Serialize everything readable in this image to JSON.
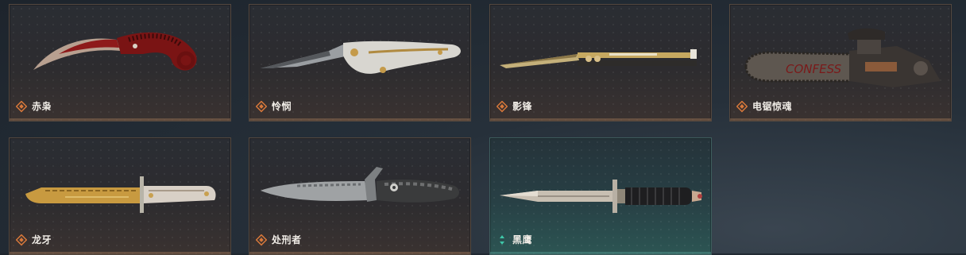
{
  "items": [
    {
      "name": "赤枭",
      "rarity": "orange",
      "weapon_icon": "karambit-knife-icon"
    },
    {
      "name": "怜悯",
      "rarity": "orange",
      "weapon_icon": "folding-knife-icon"
    },
    {
      "name": "影锋",
      "rarity": "orange",
      "weapon_icon": "butterfly-knife-icon"
    },
    {
      "name": "电锯惊魂",
      "rarity": "orange",
      "weapon_icon": "chainsaw-icon",
      "decal_text": "CONFESS"
    },
    {
      "name": "龙牙",
      "rarity": "orange",
      "weapon_icon": "bayonet-knife-icon"
    },
    {
      "name": "处刑者",
      "rarity": "orange",
      "weapon_icon": "tactical-knife-icon"
    },
    {
      "name": "黑鹰",
      "rarity": "teal",
      "weapon_icon": "dagger-knife-icon"
    }
  ],
  "colors": {
    "orange": "#d8783a",
    "teal": "#3fc7a8"
  }
}
